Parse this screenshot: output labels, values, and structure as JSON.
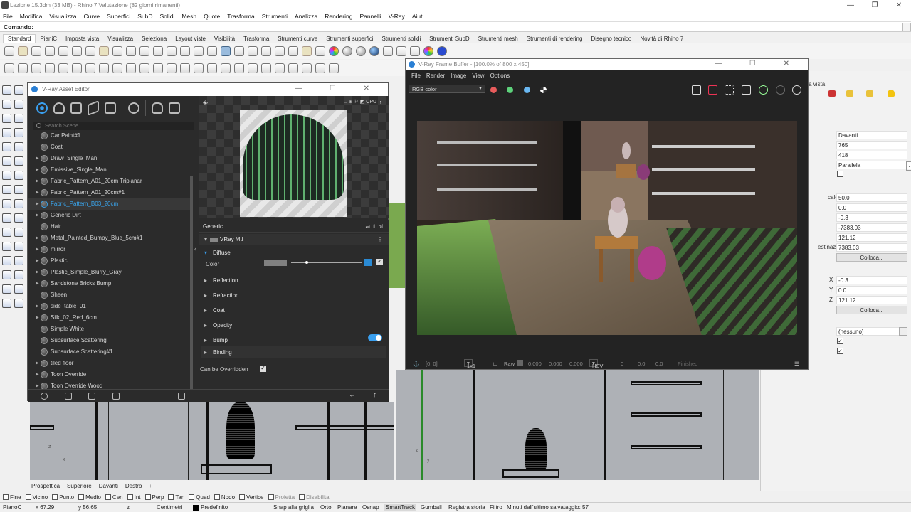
{
  "title": "Lezione 15.3dm (33 MB) - Rhino 7 Valutazione (82 giorni rimanenti)",
  "window_buttons": [
    "—",
    "❐",
    "✕"
  ],
  "menu": [
    "File",
    "Modifica",
    "Visualizza",
    "Curve",
    "Superfici",
    "SubD",
    "Solidi",
    "Mesh",
    "Quote",
    "Trasforma",
    "Strumenti",
    "Analizza",
    "Rendering",
    "Pannelli",
    "V-Ray",
    "Aiuti"
  ],
  "command_label": "Comando:",
  "toolbar_tabs": [
    "Standard",
    "PianiC",
    "Imposta vista",
    "Visualizza",
    "Seleziona",
    "Layout viste",
    "Visibilità",
    "Trasforma",
    "Strumenti curve",
    "Strumenti superfici",
    "Strumenti solidi",
    "Strumenti SubD",
    "Strumenti mesh",
    "Strumenti di rendering",
    "Disegno tecnico",
    "Novità di Rhino 7"
  ],
  "asset_editor": {
    "title": "V-Ray Asset Editor",
    "search_placeholder": "Search Scene",
    "materials": [
      {
        "name": "Car Paint#1",
        "arrow": false
      },
      {
        "name": "Coat",
        "arrow": false
      },
      {
        "name": "Draw_Single_Man",
        "arrow": true
      },
      {
        "name": "Emissive_Single_Man",
        "arrow": true
      },
      {
        "name": "Fabric_Pattern_A01_20cm Triplanar",
        "arrow": true
      },
      {
        "name": "Fabric_Pattern_A01_20cm#1",
        "arrow": true
      },
      {
        "name": "Fabric_Pattern_B03_20cm",
        "arrow": true,
        "selected": true
      },
      {
        "name": "Generic Dirt",
        "arrow": true
      },
      {
        "name": "Hair",
        "arrow": false
      },
      {
        "name": "Metal_Painted_Bumpy_Blue_5cm#1",
        "arrow": true
      },
      {
        "name": "mirror",
        "arrow": true
      },
      {
        "name": "Plastic",
        "arrow": true
      },
      {
        "name": "Plastic_Simple_Blurry_Gray",
        "arrow": true
      },
      {
        "name": "Sandstone Bricks Bump",
        "arrow": true
      },
      {
        "name": "Sheen",
        "arrow": false
      },
      {
        "name": "side_table_01",
        "arrow": true
      },
      {
        "name": "Silk_02_Red_6cm",
        "arrow": true
      },
      {
        "name": "Simple White",
        "arrow": false
      },
      {
        "name": "Subsurface Scattering",
        "arrow": false
      },
      {
        "name": "Subsurface Scattering#1",
        "arrow": false
      },
      {
        "name": "tiled floor",
        "arrow": true
      },
      {
        "name": "Toon Override",
        "arrow": true
      },
      {
        "name": "Toon Override Wood",
        "arrow": true
      }
    ],
    "preview_mode": "CPU",
    "generic_label": "Generic",
    "mtl_label": "VRay Mtl",
    "diffuse_label": "Diffuse",
    "color_label": "Color",
    "sections": [
      "Reflection",
      "Refraction",
      "Coat",
      "Opacity",
      "Bump",
      "Binding"
    ],
    "can_be_overridden": "Can be Overridden",
    "bump_enabled": true
  },
  "frame_buffer": {
    "title": "V-Ray Frame Buffer - [100.0% of 800 x 450]",
    "menu": [
      "File",
      "Render",
      "Image",
      "View",
      "Options"
    ],
    "channel": "RGB color",
    "channel_dots": [
      "#e85c5c",
      "#5dd27b",
      "#6ab8f2"
    ],
    "coords": "[0, 0]",
    "ratio": "1x1",
    "raw_label": "Raw",
    "raw_values": [
      "0.000",
      "0.000",
      "0.000"
    ],
    "color_mode": "HSV",
    "hsv_values": [
      "0",
      "0.0",
      "0.0"
    ],
    "status": "Finished"
  },
  "properties": {
    "header_fragment": "à della vista",
    "view": "Davanti",
    "width": "765",
    "height": "418",
    "projection": "Parallela",
    "scale_label": "cale(mm)",
    "scale": "50.0",
    "x1": "0.0",
    "y1": "-0.3",
    "z1": "-7383.03",
    "z2": "121.12",
    "target_label": "estinazio",
    "target": "7383.03",
    "place_btn": "Colloca...",
    "tx_label": "X",
    "tx": "-0.3",
    "ty_label": "Y",
    "ty": "0.0",
    "tz_label": "Z",
    "tz": "121.12",
    "background": "(nessuno)"
  },
  "viewport_tabs": [
    "Prospettica",
    "Superiore",
    "Davanti",
    "Destro",
    "+"
  ],
  "axis_labels": {
    "z": "z",
    "x": "x",
    "y": "y"
  },
  "snaps": [
    {
      "label": "Fine",
      "dim": false
    },
    {
      "label": "Vicino",
      "dim": false
    },
    {
      "label": "Punto",
      "dim": false
    },
    {
      "label": "Medio",
      "dim": false
    },
    {
      "label": "Cen",
      "dim": false
    },
    {
      "label": "Int",
      "dim": false
    },
    {
      "label": "Perp",
      "dim": false
    },
    {
      "label": "Tan",
      "dim": false
    },
    {
      "label": "Quad",
      "dim": false
    },
    {
      "label": "Nodo",
      "dim": false
    },
    {
      "label": "Vertice",
      "dim": false
    },
    {
      "label": "Proietta",
      "dim": true
    },
    {
      "label": "Disabilita",
      "dim": true
    }
  ],
  "status": {
    "cplane": "PianoC",
    "x": "x 67.29",
    "y": "y 56.65",
    "z": "z",
    "units": "Centimetri",
    "layer": "Predefinito",
    "toggles": [
      "Snap alla griglia",
      "Orto",
      "Planare",
      "Osnap",
      "SmartTrack",
      "Gumball",
      "Registra storia",
      "Filtro"
    ],
    "saved": "Minuti dall'ultimo salvataggio: 57"
  }
}
